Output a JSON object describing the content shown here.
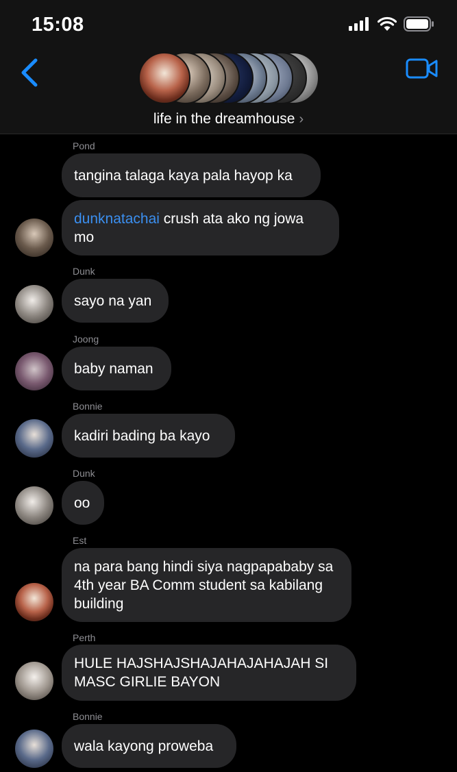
{
  "status": {
    "time": "15:08"
  },
  "header": {
    "group_name": "life in the dreamhouse",
    "chevron": "›",
    "icons": {
      "back": "chevron-left-icon",
      "video": "video-camera-icon"
    },
    "accent": "#1a8cff"
  },
  "messages": [
    {
      "sender": "Pond",
      "mention": "",
      "text": "tangina talaga kaya pala hayop ka"
    },
    {
      "sender": "",
      "mention": "dunknatachai",
      "text": " crush ata ako ng jowa mo"
    },
    {
      "sender": "Dunk",
      "mention": "",
      "text": "sayo na yan"
    },
    {
      "sender": "Joong",
      "mention": "",
      "text": "baby naman"
    },
    {
      "sender": "Bonnie",
      "mention": "",
      "text": "kadiri bading ba kayo"
    },
    {
      "sender": "Dunk",
      "mention": "",
      "text": "oo"
    },
    {
      "sender": "Est",
      "mention": "",
      "text": "na para bang hindi siya nagpapababy sa 4th year BA Comm student sa kabilang building"
    },
    {
      "sender": "Perth",
      "mention": "",
      "text": "HULE HAJSHAJSHAJAHAJAHAJAH SI MASC GIRLIE BAYON"
    },
    {
      "sender": "Bonnie",
      "mention": "",
      "text": "wala kayong proweba"
    }
  ]
}
